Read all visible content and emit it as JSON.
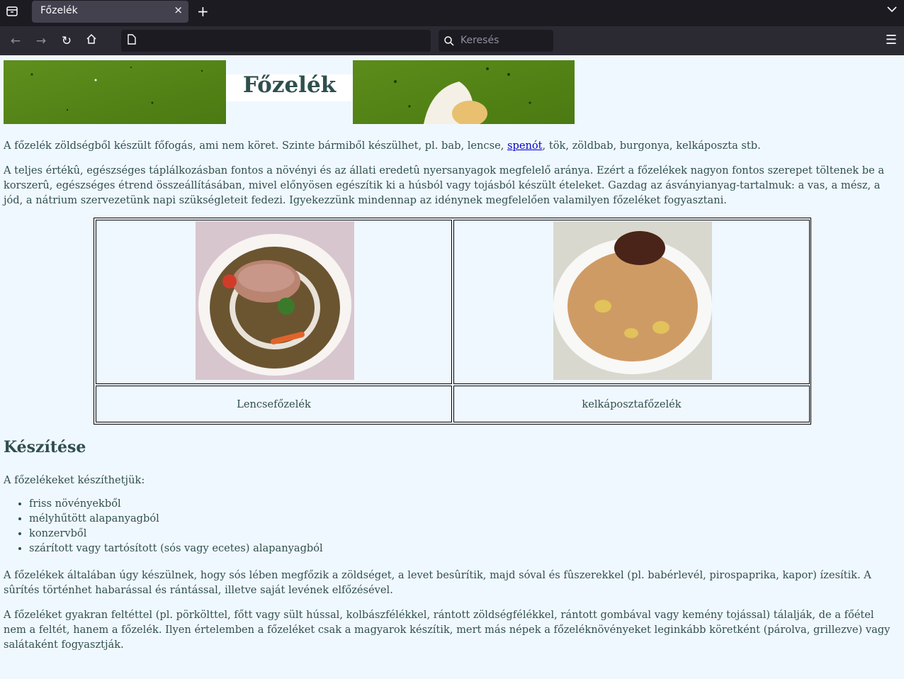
{
  "browser": {
    "tab_title": "Főzelék",
    "tab_close": "×",
    "new_tab": "+",
    "search_placeholder": "Keresés",
    "url": ""
  },
  "page": {
    "title": "Főzelék",
    "intro_before_link": "A főzelék zöldségből készült főfogás, ami nem köret. Szinte bármiből készülhet, pl. bab, lencse, ",
    "intro_link": "spenót",
    "intro_after_link": ", tök, zöldbab, burgonya, kelkáposzta stb.",
    "paragraph2": "A teljes értékû, egészséges táplálkozásban fontos a növényi és az állati eredetû nyersanyagok megfelelő aránya. Ezért a főzelékek nagyon fontos szerepet töltenek be a korszerû, egészséges étrend összeállításában, mivel előnyösen egészítik ki a húsból vagy tojásból készült ételeket. Gazdag az ásványianyag-tartalmuk: a vas, a mész, a jód, a nátrium szervezetünk napi szükségleteit fedezi. Igyekezzünk mindennap az idénynek megfelelően valamilyen főzeléket fogyasztani.",
    "table": {
      "captions": [
        "Lencsefőzelék",
        "kelkáposztafőzelék"
      ]
    },
    "section_heading": "Készítése",
    "list_intro": "A főzelékeket készíthetjük:",
    "list_items": [
      "friss növényekből",
      "mélyhűtött alapanyagból",
      "konzervből",
      "szárított vagy tartósított (sós vagy ecetes) alapanyagból"
    ],
    "paragraph3": "A főzelékek általában úgy készülnek, hogy sós lében megfőzik a zöldséget, a levet besûrítik, majd sóval és fûszerekkel (pl. babérlevél, pirospaprika, kapor) ízesítik. A sûrítés történhet habarással és rántással, illetve saját levének elfőzésével.",
    "paragraph4": "A főzeléket gyakran feltéttel (pl. pörkölttel, főtt vagy sült hússal, kolbászfélékkel, rántott zöldségfélékkel, rántott gombával vagy kemény tojással) tálalják, de a főétel nem a feltét, hanem a főzelék. Ilyen értelemben a főzeléket csak a magyarok készítik, mert más népek a főzeléknövényeket leginkább köretként (párolva, grillezve) vagy salátaként fogyasztják."
  },
  "colors": {
    "page_bg": "#f0f8ff",
    "text": "#2f4f4f",
    "link": "#0000cc"
  }
}
